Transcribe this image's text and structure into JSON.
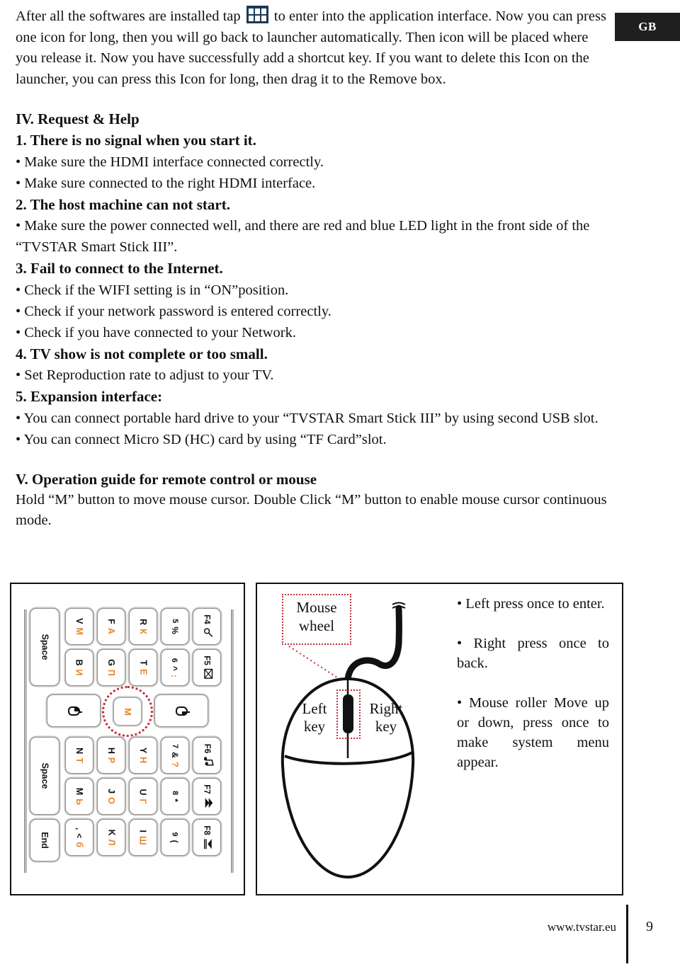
{
  "badge": {
    "label": "GB"
  },
  "intro": {
    "before_icon": "After all the softwares are installed tap",
    "after_icon": "to enter into the application interface.  Now you can press one icon for long, then you will go back to launcher automatically.  Then icon will be placed where you release it.  Now you have successfully add a shortcut key. If you want to delete this Icon on the launcher, you can press this Icon for long, then drag it to the Remove box."
  },
  "section_request": {
    "heading": "IV. Request & Help",
    "items": [
      {
        "title": "1. There is no signal when you start it.",
        "bullets": [
          "• Make sure the HDMI interface connected correctly.",
          "• Make sure connected to the right HDMI interface."
        ]
      },
      {
        "title": "2. The host machine can not start.",
        "bullets": [
          "• Make sure the power connected well, and there are red and blue LED light in the front side of the “TVSTAR Smart Stick III”."
        ]
      },
      {
        "title": "3. Fail to connect to the Internet.",
        "bullets": [
          "• Check if the WIFI setting is in “ON”position.",
          "• Check if your network password is entered correctly.",
          "• Check if you have connected to your Network."
        ]
      },
      {
        "title": "4. TV show is not complete or too small.",
        "bullets": [
          "• Set Reproduction rate to adjust to your TV."
        ]
      },
      {
        "title": "5. Expansion interface:",
        "bullets": [
          "• You can connect portable hard drive to your “TVSTAR Smart Stick III” by using second USB slot.",
          "• You can connect Micro SD (HC) card by using “TF Card”slot."
        ]
      }
    ]
  },
  "section_operation": {
    "heading": "V. Operation guide for remote control or mouse",
    "paragraph": "Hold “M” button to move mouse cursor. Double Click “M” button to enable mouse cursor continuous mode."
  },
  "keyboard": {
    "accent_color": "#e8862a",
    "highlight_color": "#c03040",
    "highlight_key": "M",
    "columns": [
      {
        "name": "space-upper",
        "keys": [
          {
            "type": "word",
            "label": "Space"
          }
        ]
      },
      {
        "name": "letters-col-1",
        "keys": [
          {
            "type": "dual",
            "latin": "V",
            "cyrillic": "М"
          },
          {
            "type": "dual",
            "latin": "B",
            "cyrillic": "И"
          }
        ]
      },
      {
        "name": "letters-col-2",
        "keys": [
          {
            "type": "dual",
            "latin": "F",
            "cyrillic": "А"
          },
          {
            "type": "dual",
            "latin": "G",
            "cyrillic": "П"
          }
        ]
      },
      {
        "name": "letters-col-3",
        "keys": [
          {
            "type": "dual",
            "latin": "R",
            "cyrillic": "К"
          },
          {
            "type": "dual",
            "latin": "T",
            "cyrillic": "Е"
          }
        ]
      },
      {
        "name": "numbers-col",
        "keys": [
          {
            "type": "num",
            "primary": "5",
            "secondary": "%"
          },
          {
            "type": "num",
            "primary": "6",
            "secondary": "^",
            "tertiary": ":"
          }
        ]
      },
      {
        "name": "function-col-upper",
        "keys": [
          {
            "type": "fn",
            "label": "F4",
            "icon": "search-icon"
          },
          {
            "type": "fn",
            "label": "F5",
            "icon": "close-window-icon"
          }
        ]
      },
      {
        "name": "letters-col-4",
        "keys": [
          {
            "type": "dual",
            "latin": "N",
            "cyrillic": "Т"
          },
          {
            "type": "dual",
            "latin": "M",
            "cyrillic": "Ь"
          },
          {
            "type": "num",
            "primary": ",",
            "secondary": "<",
            "tertiary": "б"
          }
        ]
      },
      {
        "name": "letters-col-5",
        "keys": [
          {
            "type": "dual",
            "latin": "H",
            "cyrillic": "Р"
          },
          {
            "type": "dual",
            "latin": "J",
            "cyrillic": "О"
          },
          {
            "type": "dual",
            "latin": "K",
            "cyrillic": "Л"
          }
        ]
      },
      {
        "name": "letters-col-6",
        "keys": [
          {
            "type": "dual",
            "latin": "Y",
            "cyrillic": "Н"
          },
          {
            "type": "dual",
            "latin": "U",
            "cyrillic": "Г"
          },
          {
            "type": "dual",
            "latin": "I",
            "cyrillic": "Ш"
          }
        ]
      },
      {
        "name": "numbers-col-2",
        "keys": [
          {
            "type": "num",
            "primary": "7",
            "secondary": "&",
            "tertiary": "?"
          },
          {
            "type": "num",
            "primary": "8",
            "secondary": "*"
          },
          {
            "type": "num",
            "primary": "9",
            "secondary": "("
          }
        ]
      },
      {
        "name": "function-col-lower",
        "keys": [
          {
            "type": "fn",
            "label": "F6",
            "icon": "music-note-icon"
          },
          {
            "type": "fn",
            "label": "F7",
            "icon": "previous-track-icon"
          },
          {
            "type": "fn",
            "label": "F8",
            "icon": "next-track-icon"
          }
        ]
      },
      {
        "name": "space-lower",
        "keys": [
          {
            "type": "word",
            "label": "Space"
          },
          {
            "type": "word",
            "label": "End"
          }
        ]
      }
    ],
    "mouse_row": {
      "left_key": "mouse-left-icon",
      "center_key": "M",
      "right_key": "mouse-right-icon"
    }
  },
  "mouse_figure": {
    "wheel_label_line1": "Mouse",
    "wheel_label_line2": "wheel",
    "left_label_line1": "Left",
    "left_label_line2": "key",
    "right_label_line1": "Right",
    "right_label_line2": "key"
  },
  "mouse_bullets": [
    "• Left press once to enter.",
    "• Right press once to back.",
    "• Mouse roller Move up or down, press once to make system menu appear."
  ],
  "footer": {
    "url": "www.tvstar.eu",
    "page": "9"
  }
}
